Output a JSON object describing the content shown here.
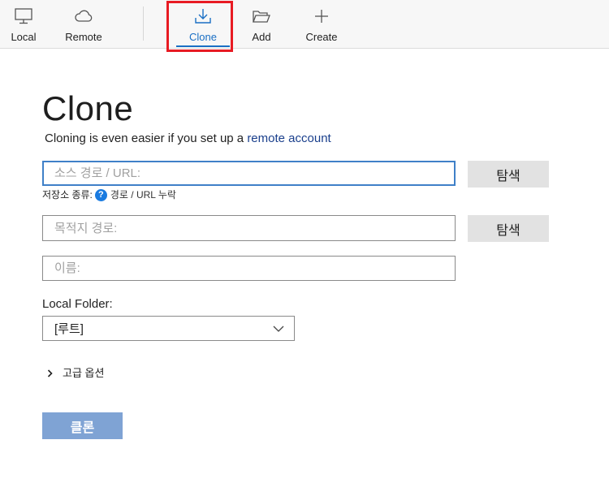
{
  "toolbar": {
    "items": [
      {
        "label": "Local",
        "icon": "monitor-icon"
      },
      {
        "label": "Remote",
        "icon": "cloud-icon"
      },
      {
        "label": "Clone",
        "icon": "download-icon",
        "active": true
      },
      {
        "label": "Add",
        "icon": "folder-open-icon"
      },
      {
        "label": "Create",
        "icon": "plus-icon"
      }
    ]
  },
  "page": {
    "title": "Clone",
    "subtitle_prefix": "Cloning is even easier if you set up a ",
    "subtitle_link": "remote account"
  },
  "form": {
    "source": {
      "placeholder": "소스 경로 / URL:",
      "value": "",
      "browse_label": "탐색"
    },
    "repo_type": {
      "label": "저장소 종류:",
      "help": "?",
      "status": "경로 / URL 누락"
    },
    "destination": {
      "placeholder": "목적지 경로:",
      "value": "",
      "browse_label": "탐색"
    },
    "name": {
      "placeholder": "이름:",
      "value": ""
    },
    "local_folder": {
      "label": "Local Folder:",
      "selected": "[루트]"
    },
    "advanced_label": "고급 옵션",
    "submit_label": "클론"
  },
  "colors": {
    "accent": "#1a6fc4",
    "link": "#1a3f8c",
    "highlight_box": "#e81b23",
    "submit_bg": "#7fa3d4",
    "help_icon": "#1a7be0"
  }
}
